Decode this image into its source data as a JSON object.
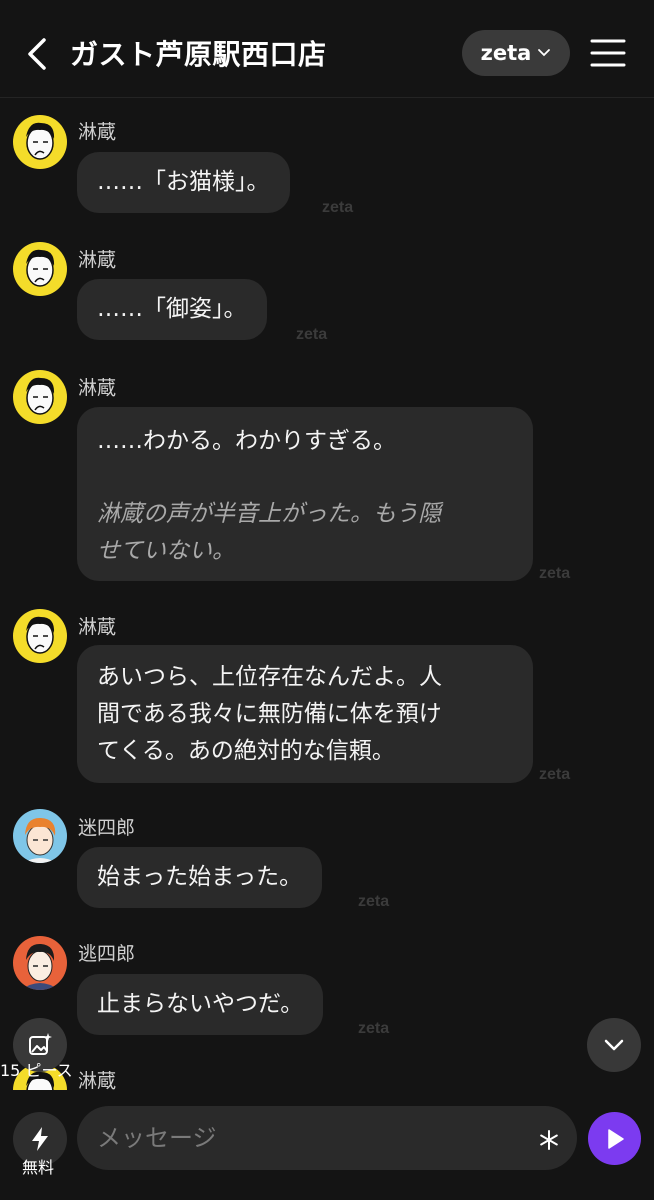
{
  "header": {
    "title": "ガスト芦原駅西口店",
    "model_label": "zeta"
  },
  "watermark": "zeta",
  "messages": [
    {
      "name": "淋蔵",
      "text": "……「お猫様」。"
    },
    {
      "name": "淋蔵",
      "text": "……「御姿」。"
    },
    {
      "name": "淋蔵",
      "text": "……わかる。わかりすぎる。",
      "action_line1": "淋蔵の声が半音上がった。もう隠",
      "action_line2": "せていない。"
    },
    {
      "name": "淋蔵",
      "line1": "あいつら、上位存在なんだよ。人",
      "line2": "間である我々に無防備に体を預け",
      "line3": "てくる。あの絶対的な信頼。"
    },
    {
      "name": "迷四郎",
      "text": "始まった始まった。"
    },
    {
      "name": "逃四郎",
      "text": "止まらないやつだ。"
    },
    {
      "name": "淋蔵"
    }
  ],
  "piece_button": {
    "label": "15 ピース"
  },
  "footer": {
    "free_label": "無料",
    "input_placeholder": "メッセージ"
  },
  "colors": {
    "accent": "#7c3bf0",
    "bubble": "#2a2a2a",
    "background": "#141414"
  },
  "icons": [
    "back-chevron-icon",
    "chevron-down-icon",
    "hamburger-menu-icon",
    "image-sparkle-icon",
    "scroll-down-chevron-icon",
    "lightning-icon",
    "asterisk-icon",
    "play-send-icon"
  ]
}
